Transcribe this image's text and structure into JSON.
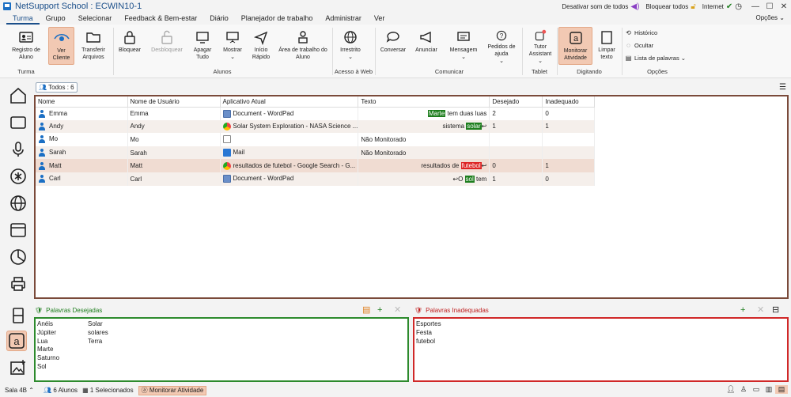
{
  "window": {
    "title": "NetSupport School : ECWIN10-1",
    "mute_label": "Desativar som de todos",
    "lock_label": "Bloquear todos",
    "internet_label": "Internet",
    "options_label": "Opções"
  },
  "menu": [
    "Turma",
    "Grupo",
    "Selecionar",
    "Feedback & Bem-estar",
    "Diário",
    "Planejador de trabalho",
    "Administrar",
    "Ver"
  ],
  "ribbon": {
    "buttons": [
      {
        "label": "Registro de Aluno",
        "icon": "register-icon"
      },
      {
        "label": "Ver Cliente",
        "icon": "eye-icon",
        "active": true
      },
      {
        "label": "Transferir Arquivos",
        "icon": "folder-icon"
      },
      {
        "label": "Bloquear",
        "icon": "lock-icon"
      },
      {
        "label": "Desbloquear",
        "icon": "unlock-icon",
        "disabled": true
      },
      {
        "label": "Apagar Tudo",
        "icon": "monitor-blank-icon"
      },
      {
        "label": "Mostrar",
        "icon": "presentation-icon"
      },
      {
        "label": "Início Rápido",
        "icon": "send-icon"
      },
      {
        "label": "Área de trabalho do Aluno",
        "icon": "student-desktop-icon"
      },
      {
        "label": "Irrestrito",
        "icon": "globe-icon"
      },
      {
        "label": "Conversar",
        "icon": "chat-icon"
      },
      {
        "label": "Anunciar",
        "icon": "megaphone-icon"
      },
      {
        "label": "Mensagem",
        "icon": "message-icon"
      },
      {
        "label": "Pedidos de ajuda",
        "icon": "help-icon"
      },
      {
        "label": "Tutor Assistant",
        "icon": "tutor-icon"
      },
      {
        "label": "Monitorar Atividade",
        "icon": "typing-icon",
        "active": true
      },
      {
        "label": "Limpar texto",
        "icon": "clear-text-icon"
      }
    ],
    "groups": [
      "Turma",
      "Alunos",
      "Acesso à Web",
      "Comunicar",
      "Tablet",
      "Digitando",
      "Opções"
    ],
    "options": [
      "Histórico",
      "Ocultar",
      "Lista de palavras"
    ]
  },
  "todos_label": "Todos : 6",
  "table": {
    "headers": [
      "Nome",
      "Nome de Usuário",
      "Aplicativo Atual",
      "Texto",
      "Desejado",
      "Inadequado"
    ],
    "rows": [
      {
        "name": "Emma",
        "user": "Emma",
        "app": "Document - WordPad",
        "app_icon": "wordpad",
        "text_pre": "",
        "text_hl": "Marte",
        "text_post": " tem duas luas",
        "hl": "g",
        "desired": "2",
        "inadequate": "0"
      },
      {
        "name": "Andy",
        "user": "Andy",
        "app": "Solar System Exploration - NASA Science ...",
        "app_icon": "chrome",
        "text_pre": "sistema ",
        "text_hl": "solar",
        "text_post": "↩",
        "hl": "g",
        "desired": "1",
        "inadequate": "1"
      },
      {
        "name": "Mo",
        "user": "Mo",
        "app": "",
        "app_icon": "blank",
        "text_pre": "Não Monitorado",
        "text_hl": "",
        "text_post": "",
        "hl": "",
        "desired": "",
        "inadequate": "",
        "left": true
      },
      {
        "name": "Sarah",
        "user": "Sarah",
        "app": "Mail",
        "app_icon": "mail",
        "text_pre": "Não Monitorado",
        "text_hl": "",
        "text_post": "",
        "hl": "",
        "desired": "",
        "inadequate": "",
        "left": true
      },
      {
        "name": "Matt",
        "user": "Matt",
        "app": "resultados de futebol - Google Search - G...",
        "app_icon": "chrome",
        "text_pre": "resultados de ",
        "text_hl": "futebol",
        "text_post": "↩",
        "hl": "r",
        "desired": "0",
        "inadequate": "1"
      },
      {
        "name": "Carl",
        "user": "Carl",
        "app": "Document - WordPad",
        "app_icon": "wordpad",
        "text_pre": "↩O ",
        "text_hl": "sol",
        "text_post": " tem",
        "hl": "g",
        "desired": "1",
        "inadequate": "0"
      }
    ]
  },
  "desired_panel": {
    "title": "Palavras Desejadas",
    "col1": [
      "Anéis",
      "Júpiter",
      "Lua",
      "Marte",
      "Saturno",
      "Sol"
    ],
    "col2": [
      "Solar",
      "solares",
      "Terra"
    ]
  },
  "inadequate_panel": {
    "title": "Palavras Inadequadas",
    "col1": [
      "Esportes",
      "Festa",
      "futebol"
    ]
  },
  "status": {
    "room": "Sala 4B",
    "students": "6 Alunos",
    "selected": "1 Selecionados",
    "mode": "Monitorar Atividade"
  },
  "colors": {
    "accent": "#1b4f8a",
    "active_bg": "#f2c9b3",
    "desired": "#2d8a2d",
    "inadequate": "#d02828"
  }
}
